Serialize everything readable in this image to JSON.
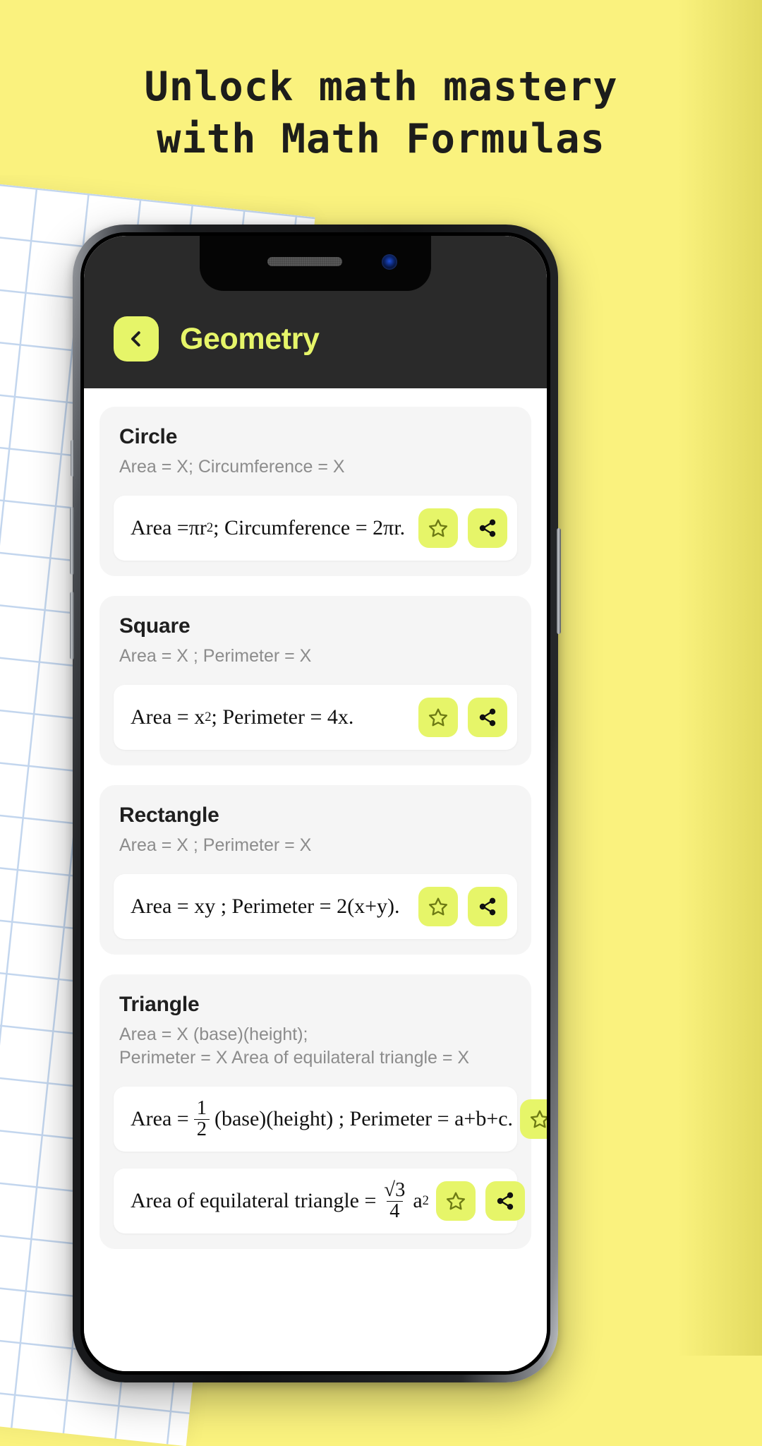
{
  "promo": {
    "headline_line1": "Unlock math mastery",
    "headline_line2": "with Math Formulas",
    "background_color": "#FAF27E",
    "accent_color": "#E6F569"
  },
  "app": {
    "header": {
      "back_icon": "chevron-left-icon",
      "title": "Geometry"
    },
    "cards": [
      {
        "title": "Circle",
        "subtitle": "Area = X; Circumference = X",
        "formulas": [
          {
            "prefix": "Area = ",
            "pi": "π",
            "base": "r",
            "exp": "2",
            "mid": "; Circumference = 2",
            "pi2": "π",
            "suffix": "r.",
            "plain": "Area = πr²; Circumference = 2πr.",
            "favorite_icon": "star-icon",
            "share_icon": "share-icon"
          }
        ]
      },
      {
        "title": "Square",
        "subtitle": "Area = X ; Perimeter = X",
        "formulas": [
          {
            "prefix": "Area = x",
            "exp": "2",
            "suffix": "; Perimeter = 4x.",
            "plain": "Area = x² ; Perimeter = 4x.",
            "favorite_icon": "star-icon",
            "share_icon": "share-icon"
          }
        ]
      },
      {
        "title": "Rectangle",
        "subtitle": "Area = X ; Perimeter = X",
        "formulas": [
          {
            "plain": "Area = xy ; Perimeter = 2(x+y).",
            "favorite_icon": "star-icon",
            "share_icon": "share-icon"
          }
        ]
      },
      {
        "title": "Triangle",
        "subtitle_line1": "Area = X (base)(height);",
        "subtitle_line2": "Perimeter = X Area of equilateral triangle = X",
        "formulas": [
          {
            "prefix": "Area = ",
            "frac_num": "1",
            "frac_den": "2",
            "suffix": "(base)(height) ; Perimeter = a+b+c.",
            "plain": "Area = 1/2 (base)(height) ; Perimeter = a+b+c.",
            "favorite_icon": "star-icon",
            "share_icon": "share-icon"
          },
          {
            "prefix": "Area of equilateral triangle = ",
            "frac_num": "√3",
            "frac_den": "4",
            "base": "a",
            "exp": "2",
            "plain": "Area of equilateral triangle = √3/4 a²",
            "favorite_icon": "star-icon",
            "share_icon": "share-icon"
          }
        ]
      }
    ]
  }
}
